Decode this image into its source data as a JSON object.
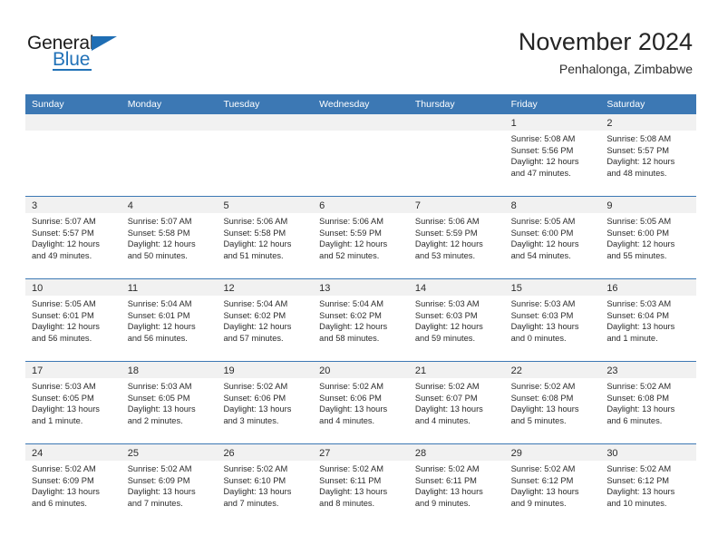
{
  "brand": {
    "name_part1": "General",
    "name_part2": "Blue"
  },
  "header": {
    "title": "November 2024",
    "location": "Penhalonga, Zimbabwe"
  },
  "calendar": {
    "weekdays": [
      "Sunday",
      "Monday",
      "Tuesday",
      "Wednesday",
      "Thursday",
      "Friday",
      "Saturday"
    ],
    "accent_color": "#3c78b4",
    "band_color": "#f1f1f1",
    "weeks": [
      [
        {
          "day": "",
          "lines": []
        },
        {
          "day": "",
          "lines": []
        },
        {
          "day": "",
          "lines": []
        },
        {
          "day": "",
          "lines": []
        },
        {
          "day": "",
          "lines": []
        },
        {
          "day": "1",
          "lines": [
            "Sunrise: 5:08 AM",
            "Sunset: 5:56 PM",
            "Daylight: 12 hours",
            "and 47 minutes."
          ]
        },
        {
          "day": "2",
          "lines": [
            "Sunrise: 5:08 AM",
            "Sunset: 5:57 PM",
            "Daylight: 12 hours",
            "and 48 minutes."
          ]
        }
      ],
      [
        {
          "day": "3",
          "lines": [
            "Sunrise: 5:07 AM",
            "Sunset: 5:57 PM",
            "Daylight: 12 hours",
            "and 49 minutes."
          ]
        },
        {
          "day": "4",
          "lines": [
            "Sunrise: 5:07 AM",
            "Sunset: 5:58 PM",
            "Daylight: 12 hours",
            "and 50 minutes."
          ]
        },
        {
          "day": "5",
          "lines": [
            "Sunrise: 5:06 AM",
            "Sunset: 5:58 PM",
            "Daylight: 12 hours",
            "and 51 minutes."
          ]
        },
        {
          "day": "6",
          "lines": [
            "Sunrise: 5:06 AM",
            "Sunset: 5:59 PM",
            "Daylight: 12 hours",
            "and 52 minutes."
          ]
        },
        {
          "day": "7",
          "lines": [
            "Sunrise: 5:06 AM",
            "Sunset: 5:59 PM",
            "Daylight: 12 hours",
            "and 53 minutes."
          ]
        },
        {
          "day": "8",
          "lines": [
            "Sunrise: 5:05 AM",
            "Sunset: 6:00 PM",
            "Daylight: 12 hours",
            "and 54 minutes."
          ]
        },
        {
          "day": "9",
          "lines": [
            "Sunrise: 5:05 AM",
            "Sunset: 6:00 PM",
            "Daylight: 12 hours",
            "and 55 minutes."
          ]
        }
      ],
      [
        {
          "day": "10",
          "lines": [
            "Sunrise: 5:05 AM",
            "Sunset: 6:01 PM",
            "Daylight: 12 hours",
            "and 56 minutes."
          ]
        },
        {
          "day": "11",
          "lines": [
            "Sunrise: 5:04 AM",
            "Sunset: 6:01 PM",
            "Daylight: 12 hours",
            "and 56 minutes."
          ]
        },
        {
          "day": "12",
          "lines": [
            "Sunrise: 5:04 AM",
            "Sunset: 6:02 PM",
            "Daylight: 12 hours",
            "and 57 minutes."
          ]
        },
        {
          "day": "13",
          "lines": [
            "Sunrise: 5:04 AM",
            "Sunset: 6:02 PM",
            "Daylight: 12 hours",
            "and 58 minutes."
          ]
        },
        {
          "day": "14",
          "lines": [
            "Sunrise: 5:03 AM",
            "Sunset: 6:03 PM",
            "Daylight: 12 hours",
            "and 59 minutes."
          ]
        },
        {
          "day": "15",
          "lines": [
            "Sunrise: 5:03 AM",
            "Sunset: 6:03 PM",
            "Daylight: 13 hours",
            "and 0 minutes."
          ]
        },
        {
          "day": "16",
          "lines": [
            "Sunrise: 5:03 AM",
            "Sunset: 6:04 PM",
            "Daylight: 13 hours",
            "and 1 minute."
          ]
        }
      ],
      [
        {
          "day": "17",
          "lines": [
            "Sunrise: 5:03 AM",
            "Sunset: 6:05 PM",
            "Daylight: 13 hours",
            "and 1 minute."
          ]
        },
        {
          "day": "18",
          "lines": [
            "Sunrise: 5:03 AM",
            "Sunset: 6:05 PM",
            "Daylight: 13 hours",
            "and 2 minutes."
          ]
        },
        {
          "day": "19",
          "lines": [
            "Sunrise: 5:02 AM",
            "Sunset: 6:06 PM",
            "Daylight: 13 hours",
            "and 3 minutes."
          ]
        },
        {
          "day": "20",
          "lines": [
            "Sunrise: 5:02 AM",
            "Sunset: 6:06 PM",
            "Daylight: 13 hours",
            "and 4 minutes."
          ]
        },
        {
          "day": "21",
          "lines": [
            "Sunrise: 5:02 AM",
            "Sunset: 6:07 PM",
            "Daylight: 13 hours",
            "and 4 minutes."
          ]
        },
        {
          "day": "22",
          "lines": [
            "Sunrise: 5:02 AM",
            "Sunset: 6:08 PM",
            "Daylight: 13 hours",
            "and 5 minutes."
          ]
        },
        {
          "day": "23",
          "lines": [
            "Sunrise: 5:02 AM",
            "Sunset: 6:08 PM",
            "Daylight: 13 hours",
            "and 6 minutes."
          ]
        }
      ],
      [
        {
          "day": "24",
          "lines": [
            "Sunrise: 5:02 AM",
            "Sunset: 6:09 PM",
            "Daylight: 13 hours",
            "and 6 minutes."
          ]
        },
        {
          "day": "25",
          "lines": [
            "Sunrise: 5:02 AM",
            "Sunset: 6:09 PM",
            "Daylight: 13 hours",
            "and 7 minutes."
          ]
        },
        {
          "day": "26",
          "lines": [
            "Sunrise: 5:02 AM",
            "Sunset: 6:10 PM",
            "Daylight: 13 hours",
            "and 7 minutes."
          ]
        },
        {
          "day": "27",
          "lines": [
            "Sunrise: 5:02 AM",
            "Sunset: 6:11 PM",
            "Daylight: 13 hours",
            "and 8 minutes."
          ]
        },
        {
          "day": "28",
          "lines": [
            "Sunrise: 5:02 AM",
            "Sunset: 6:11 PM",
            "Daylight: 13 hours",
            "and 9 minutes."
          ]
        },
        {
          "day": "29",
          "lines": [
            "Sunrise: 5:02 AM",
            "Sunset: 6:12 PM",
            "Daylight: 13 hours",
            "and 9 minutes."
          ]
        },
        {
          "day": "30",
          "lines": [
            "Sunrise: 5:02 AM",
            "Sunset: 6:12 PM",
            "Daylight: 13 hours",
            "and 10 minutes."
          ]
        }
      ]
    ]
  }
}
